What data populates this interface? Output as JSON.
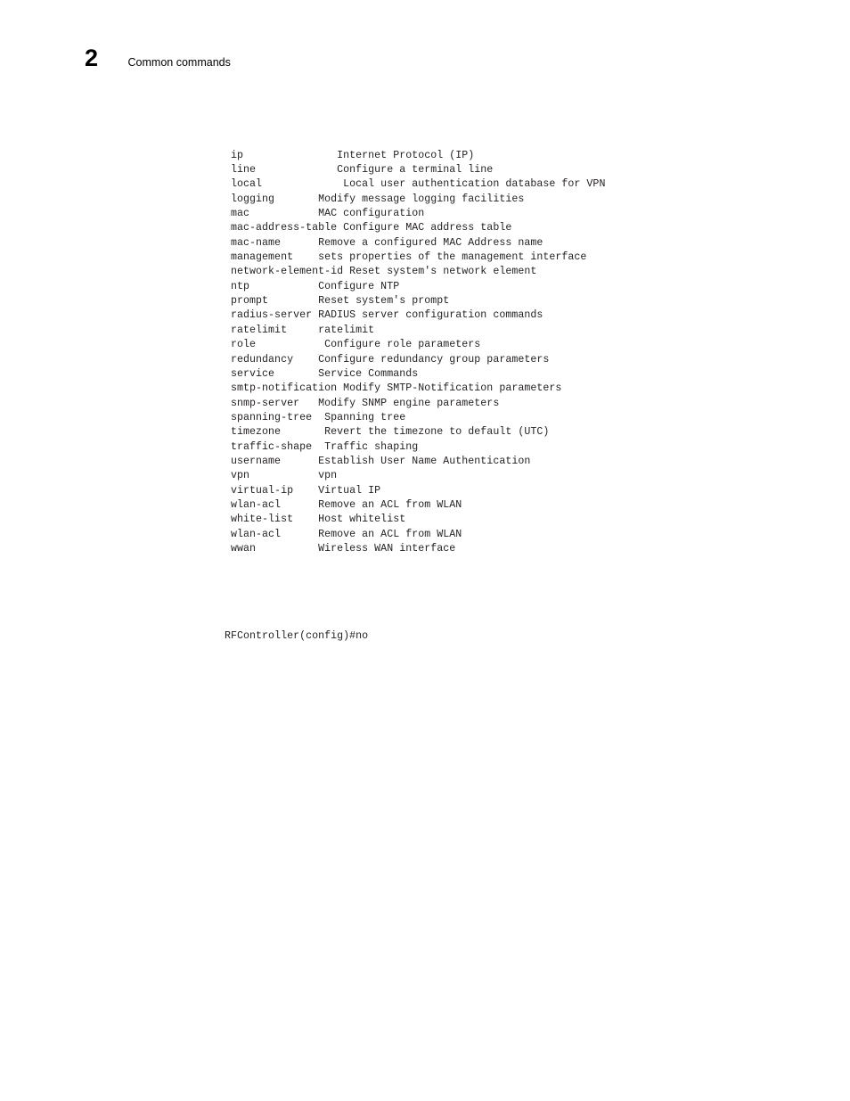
{
  "header": {
    "chapter_number": "2",
    "chapter_title": "Common commands"
  },
  "terminal": {
    "lines": [
      " ip               Internet Protocol (IP)",
      " line             Configure a terminal line",
      " local             Local user authentication database for VPN",
      " logging       Modify message logging facilities",
      " mac           MAC configuration",
      " mac-address-table Configure MAC address table",
      " mac-name      Remove a configured MAC Address name",
      " management    sets properties of the management interface",
      " network-element-id Reset system's network element",
      " ntp           Configure NTP",
      " prompt        Reset system's prompt",
      " radius-server RADIUS server configuration commands",
      " ratelimit     ratelimit",
      " role           Configure role parameters",
      " redundancy    Configure redundancy group parameters",
      " service       Service Commands",
      " smtp-notification Modify SMTP-Notification parameters",
      " snmp-server   Modify SNMP engine parameters",
      " spanning-tree  Spanning tree",
      " timezone       Revert the timezone to default (UTC)",
      " traffic-shape  Traffic shaping",
      " username      Establish User Name Authentication",
      " vpn           vpn",
      " virtual-ip    Virtual IP",
      " wlan-acl      Remove an ACL from WLAN",
      " white-list    Host whitelist",
      " wlan-acl      Remove an ACL from WLAN",
      " wwan          Wireless WAN interface"
    ],
    "blank_line": "",
    "prompt": "RFController(config)#no"
  }
}
